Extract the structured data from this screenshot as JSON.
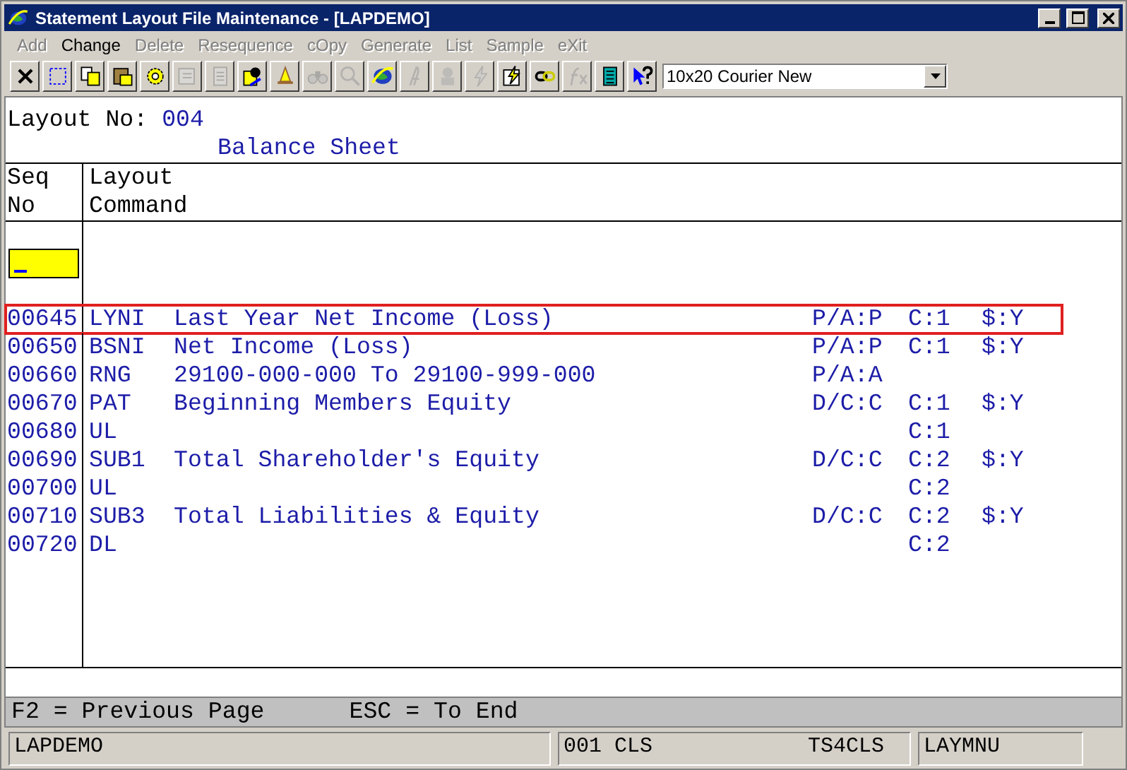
{
  "window": {
    "title": "Statement Layout File Maintenance - [LAPDEMO]"
  },
  "menu": [
    {
      "label": "Add",
      "disabled": true
    },
    {
      "label": "Change",
      "disabled": false
    },
    {
      "label": "Delete",
      "disabled": true
    },
    {
      "label": "Resequence",
      "disabled": true
    },
    {
      "label": "cOpy",
      "disabled": true
    },
    {
      "label": "Generate",
      "disabled": true
    },
    {
      "label": "List",
      "disabled": true
    },
    {
      "label": "Sample",
      "disabled": true
    },
    {
      "label": "eXit",
      "disabled": true
    }
  ],
  "toolbar": [
    {
      "disabled": false
    },
    {
      "disabled": false
    },
    {
      "disabled": false
    },
    {
      "disabled": false
    },
    {
      "disabled": false
    },
    {
      "disabled": true
    },
    {
      "disabled": true
    },
    {
      "disabled": false
    },
    {
      "disabled": false
    },
    {
      "disabled": true
    },
    {
      "disabled": true
    },
    {
      "disabled": false
    },
    {
      "disabled": true
    },
    {
      "disabled": true
    },
    {
      "disabled": true
    },
    {
      "disabled": false
    },
    {
      "disabled": false
    },
    {
      "disabled": true
    },
    {
      "disabled": false
    },
    {
      "disabled": false
    }
  ],
  "font_select": {
    "value": "10x20 Courier New"
  },
  "layout_no": {
    "label": "Layout No:",
    "value": "004"
  },
  "layout_name": "Balance Sheet",
  "columns": [
    [
      "Seq",
      "No"
    ],
    [
      "Layout",
      "Command"
    ]
  ],
  "rows": [
    {
      "seq": "00645",
      "command": "LYNI",
      "description": "Last Year Net Income (Loss)",
      "col4": "P/A:P",
      "col5": "C:1",
      "col6": "$:Y",
      "selected": true
    },
    {
      "seq": "00650",
      "command": "BSNI",
      "description": "Net Income (Loss)",
      "col4": "P/A:P",
      "col5": "C:1",
      "col6": "$:Y",
      "selected": false
    },
    {
      "seq": "00660",
      "command": "RNG",
      "description": "29100-000-000 To 29100-999-000",
      "col4": "P/A:A",
      "selected": false
    },
    {
      "seq": "00670",
      "command": "PAT",
      "description": "Beginning Members Equity",
      "col4": "D/C:C",
      "col5": "C:1",
      "col6": "$:Y",
      "selected": false
    },
    {
      "seq": "00680",
      "command": "UL",
      "col5": "C:1",
      "selected": false
    },
    {
      "seq": "00690",
      "command": "SUB1",
      "description": "Total Shareholder's Equity",
      "col4": "D/C:C",
      "col5": "C:2",
      "col6": "$:Y",
      "selected": false
    },
    {
      "seq": "00700",
      "command": "UL",
      "col5": "C:2",
      "selected": false
    },
    {
      "seq": "00710",
      "command": "SUB3",
      "description": "Total Liabilities & Equity",
      "col4": "D/C:C",
      "col5": "C:2",
      "col6": "$:Y",
      "selected": false
    },
    {
      "seq": "00720",
      "command": "DL",
      "col5": "C:2",
      "selected": false
    }
  ],
  "footer": [
    "F2 = Previous Page",
    "ESC = To End"
  ],
  "status_bar": [
    [
      "LAPDEMO"
    ],
    [
      "001 CLS",
      "TS4CLS"
    ],
    [
      "LAYMNU"
    ]
  ]
}
